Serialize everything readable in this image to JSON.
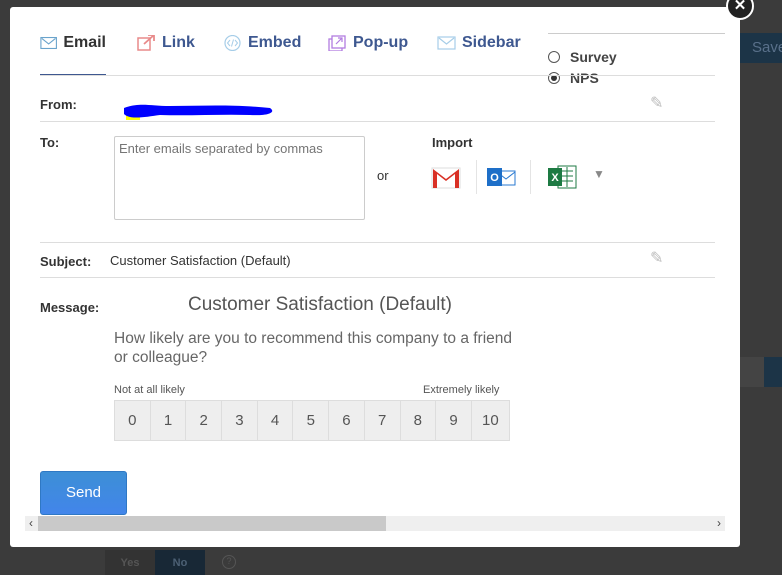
{
  "background": {
    "save_label": "Save",
    "yes_label": "Yes",
    "no_label": "No",
    "help_label": "?"
  },
  "tabs": [
    {
      "label": "Email",
      "icon": "envelope-icon",
      "active": true
    },
    {
      "label": "Link",
      "icon": "external-link-icon"
    },
    {
      "label": "Embed",
      "icon": "code-icon"
    },
    {
      "label": "Pop-up",
      "icon": "popup-icon"
    },
    {
      "label": "Sidebar",
      "icon": "sidebar-envelope-icon"
    }
  ],
  "survey_type": {
    "options": [
      {
        "label": "Survey",
        "selected": false
      },
      {
        "label": "NPS",
        "selected": true
      }
    ]
  },
  "form": {
    "from_label": "From:",
    "to_label": "To:",
    "to_placeholder": "Enter emails separated by commas",
    "or_label": "or",
    "import_label": "Import",
    "import_sources": [
      "gmail-icon",
      "outlook-icon",
      "excel-icon"
    ],
    "subject_label": "Subject:",
    "subject_value": "Customer Satisfaction (Default)",
    "message_label": "Message:"
  },
  "message": {
    "title": "Customer Satisfaction (Default)",
    "question": "How likely are you to recommend this company to a friend or colleague?",
    "low_label": "Not at all likely",
    "high_label": "Extremely likely",
    "scale": [
      "0",
      "1",
      "2",
      "3",
      "4",
      "5",
      "6",
      "7",
      "8",
      "9",
      "10"
    ]
  },
  "send_label": "Send",
  "colors": {
    "accent": "#3e5890",
    "send": "#4285ea",
    "redaction": "#0000ff"
  }
}
